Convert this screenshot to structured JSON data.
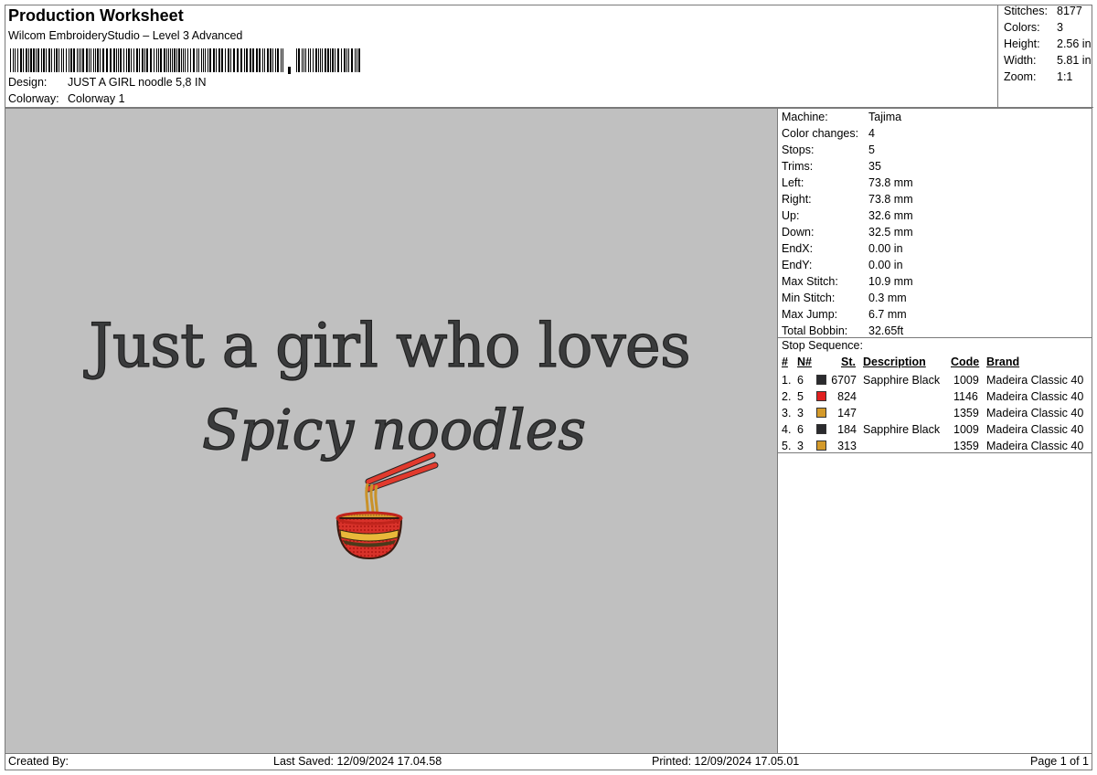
{
  "header": {
    "title": "Production Worksheet",
    "software": "Wilcom EmbroideryStudio – Level 3 Advanced",
    "design_label": "Design:",
    "design_value": "JUST A GIRL noodle 5,8 IN",
    "colorway_label": "Colorway:",
    "colorway_value": "Colorway 1"
  },
  "stats": [
    {
      "label": "Stitches:",
      "value": "8177"
    },
    {
      "label": "Colors:",
      "value": "3"
    },
    {
      "label": "Height:",
      "value": "2.56 in"
    },
    {
      "label": "Width:",
      "value": "5.81 in"
    },
    {
      "label": "Zoom:",
      "value": "1:1"
    }
  ],
  "design": {
    "line1": "Just a girl who loves",
    "line2": "Spicy noodles"
  },
  "machine_info": [
    {
      "label": "Machine:",
      "value": "Tajima"
    },
    {
      "label": "Color changes:",
      "value": "4"
    },
    {
      "label": "Stops:",
      "value": "5"
    },
    {
      "label": "Trims:",
      "value": "35"
    },
    {
      "label": "Left:",
      "value": "73.8 mm"
    },
    {
      "label": "Right:",
      "value": "73.8 mm"
    },
    {
      "label": "Up:",
      "value": "32.6 mm"
    },
    {
      "label": "Down:",
      "value": "32.5 mm"
    },
    {
      "label": "EndX:",
      "value": "0.00 in"
    },
    {
      "label": "EndY:",
      "value": "0.00 in"
    },
    {
      "label": "Max Stitch:",
      "value": "10.9 mm"
    },
    {
      "label": "Min Stitch:",
      "value": "0.3 mm"
    },
    {
      "label": "Max Jump:",
      "value": "6.7 mm"
    },
    {
      "label": "Total Bobbin:",
      "value": "32.65ft"
    }
  ],
  "stop_sequence": {
    "title": "Stop Sequence:",
    "headers": {
      "num": "#",
      "n": "N#",
      "st": "St.",
      "description": "Description",
      "code": "Code",
      "brand": "Brand"
    },
    "rows": [
      {
        "num": "1.",
        "n": "6",
        "color": "#2b2b2e",
        "st": "6707",
        "description": "Sapphire Black",
        "code": "1009",
        "brand": "Madeira Classic 40"
      },
      {
        "num": "2.",
        "n": "5",
        "color": "#e02020",
        "st": "824",
        "description": "",
        "code": "1146",
        "brand": "Madeira Classic 40"
      },
      {
        "num": "3.",
        "n": "3",
        "color": "#d49a2a",
        "st": "147",
        "description": "",
        "code": "1359",
        "brand": "Madeira Classic 40"
      },
      {
        "num": "4.",
        "n": "6",
        "color": "#2b2b2e",
        "st": "184",
        "description": "Sapphire Black",
        "code": "1009",
        "brand": "Madeira Classic 40"
      },
      {
        "num": "5.",
        "n": "3",
        "color": "#d49a2a",
        "st": "313",
        "description": "",
        "code": "1359",
        "brand": "Madeira Classic 40"
      }
    ]
  },
  "footer": {
    "created_by": "Created By:",
    "last_saved": "Last Saved: 12/09/2024 17.04.58",
    "printed": "Printed: 12/09/2024 17.05.01",
    "page": "Page 1 of 1"
  }
}
